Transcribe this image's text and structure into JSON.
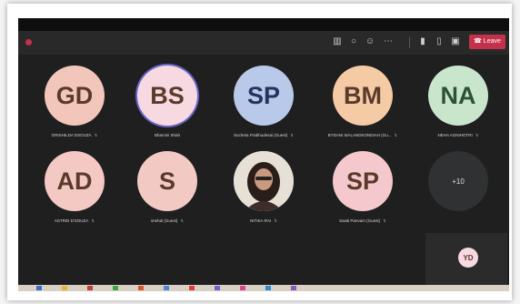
{
  "window": {
    "title": ""
  },
  "toolbar": {
    "timer": "",
    "leave_label": "Leave"
  },
  "colors": {
    "leave": "#c4314b",
    "gd": "#f2c6bb",
    "bs": "#f7d9e1",
    "sp": "#b9c9ea",
    "bm": "#f5cba6",
    "na": "#c9e6cd",
    "ad": "#f4c8c3",
    "s": "#f3c9c3",
    "sp2": "#f4c8cc",
    "more": "#2f3133"
  },
  "participants": [
    {
      "initials": "GD",
      "name": "GRISHILDA DSOUZA"
    },
    {
      "initials": "BS",
      "name": "Bhamini Shah"
    },
    {
      "initials": "SP",
      "name": "Sucheta Prabhudesai (Guest)"
    },
    {
      "initials": "BM",
      "name": "BYDANI MALANDKONDIAH (Gu..."
    },
    {
      "initials": "NA",
      "name": "NEHA AGNIHOTRI"
    },
    {
      "initials": "AD",
      "name": "ASTRID D'SOUZA"
    },
    {
      "initials": "S",
      "name": "snehal (Guest)"
    },
    {
      "initials": "",
      "name": "NITIKA RAI"
    },
    {
      "initials": "SP",
      "name": "Swati Panvam (Guest)"
    },
    {
      "initials": "+10",
      "name": ""
    }
  ],
  "self_view": {
    "initials": "YD"
  }
}
